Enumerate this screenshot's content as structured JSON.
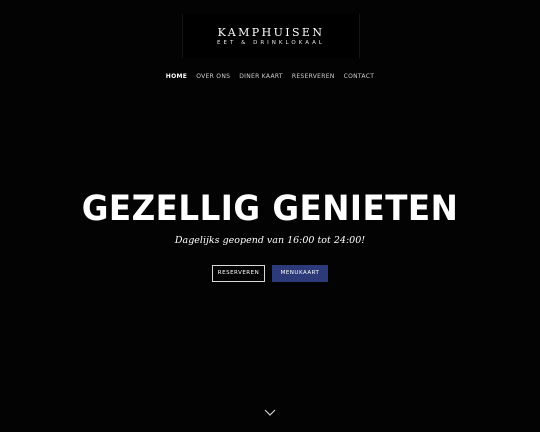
{
  "logo": {
    "title": "Kamphuisen",
    "subtitle": "Eet & Drinklokaal"
  },
  "nav": {
    "items": [
      {
        "label": "Home"
      },
      {
        "label": "Over ons"
      },
      {
        "label": "Diner kaart"
      },
      {
        "label": "Reserveren"
      },
      {
        "label": "Contact"
      }
    ]
  },
  "hero": {
    "title": "GEZELLIG GENIETEN",
    "subtitle": "Dagelijks geopend van 16:00 tot 24:00!",
    "primary_button": "Reserveren",
    "secondary_button": "Menukaart"
  },
  "icons": {
    "scroll": "chevron-down-icon"
  },
  "colors": {
    "background": "#030303",
    "accent": "#2c3a7a",
    "text": "#ffffff"
  }
}
